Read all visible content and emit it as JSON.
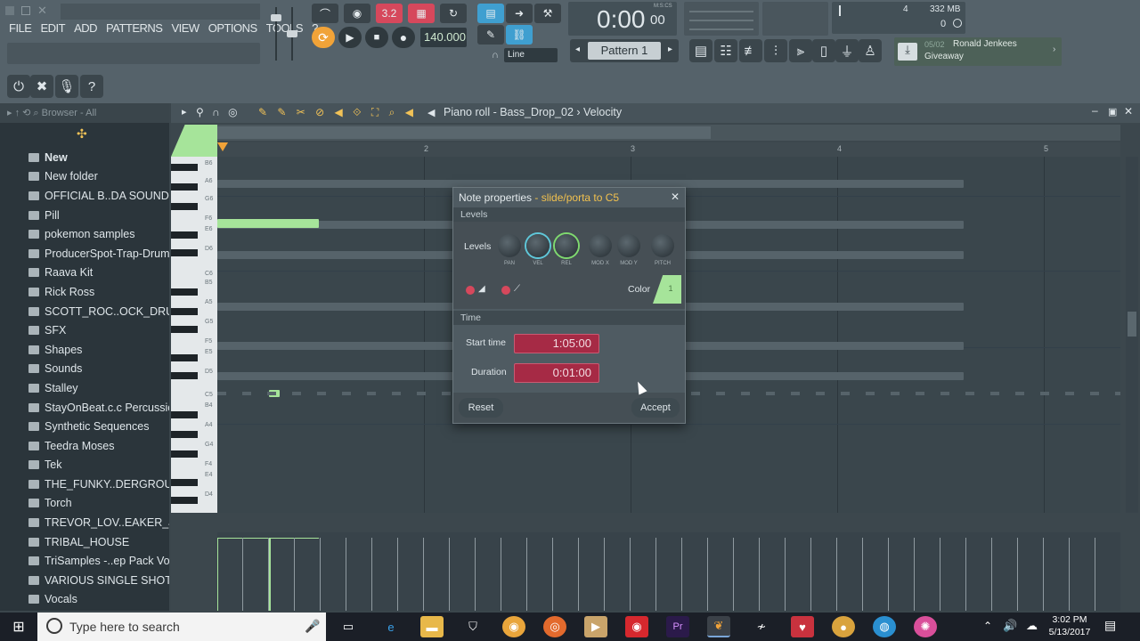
{
  "menu": [
    "FILE",
    "EDIT",
    "ADD",
    "PATTERNS",
    "VIEW",
    "OPTIONS",
    "TOOLS",
    "?"
  ],
  "transport": {
    "tempo": "140.000",
    "time": "0:00",
    "time_small": "00",
    "time_unit": "M:S:CS",
    "pattern": "Pattern 1",
    "snap": "Line",
    "mode_badge": "3.2"
  },
  "meters": {
    "memory": "332 MB",
    "cpu": "4",
    "polyphony": "0"
  },
  "news": {
    "counter": "05/02",
    "line1": "Ronald Jenkees",
    "line2": "Giveaway"
  },
  "browser": {
    "header": "Browser - All",
    "items": [
      "New",
      "New folder",
      "OFFICIAL B..DA SOUNDKIT",
      "Pill",
      "pokemon samples",
      "ProducerSpot-Trap-Drums",
      "Raava Kit",
      "Rick Ross",
      "SCOTT_ROC..OCK_DRUMS",
      "SFX",
      "Shapes",
      "Sounds",
      "Stalley",
      "StayOnBeat.c.c Percussion",
      "Synthetic Sequences",
      "Teedra Moses",
      "Tek",
      "THE_FUNKY..DERGROUND",
      "Torch",
      "TREVOR_LOV..EAKER_JUNK",
      "TRIBAL_HOUSE",
      "TriSamples -..ep Pack Vol 1",
      "VARIOUS SINGLE SHOTS",
      "Vocals"
    ]
  },
  "piano_roll": {
    "title": "Piano roll - Bass_Drop_02 › Velocity",
    "bar_numbers": [
      "2",
      "3",
      "4",
      "5"
    ],
    "key_labels": [
      "B6",
      "A6",
      "G6",
      "F6",
      "E6",
      "D6",
      "C6",
      "B5",
      "A5",
      "G5",
      "F5",
      "E5",
      "D5",
      "C5",
      "B4",
      "A4",
      "G4",
      "F4",
      "E4",
      "D4"
    ]
  },
  "dialog": {
    "title": "Note properties",
    "title_accent": "- slide/porta to C5",
    "levels_header": "Levels",
    "levels_label": "Levels",
    "knobs": [
      "PAN",
      "VEL",
      "REL",
      "MOD X",
      "MOD Y",
      "PITCH"
    ],
    "color_label": "Color",
    "color_value": "1",
    "time_header": "Time",
    "start_time_label": "Start time",
    "start_time": "1:05:00",
    "duration_label": "Duration",
    "duration": "0:01:00",
    "reset": "Reset",
    "accept": "Accept"
  },
  "taskbar": {
    "search_placeholder": "Type here to search",
    "time": "3:02 PM",
    "date": "5/13/2017"
  }
}
